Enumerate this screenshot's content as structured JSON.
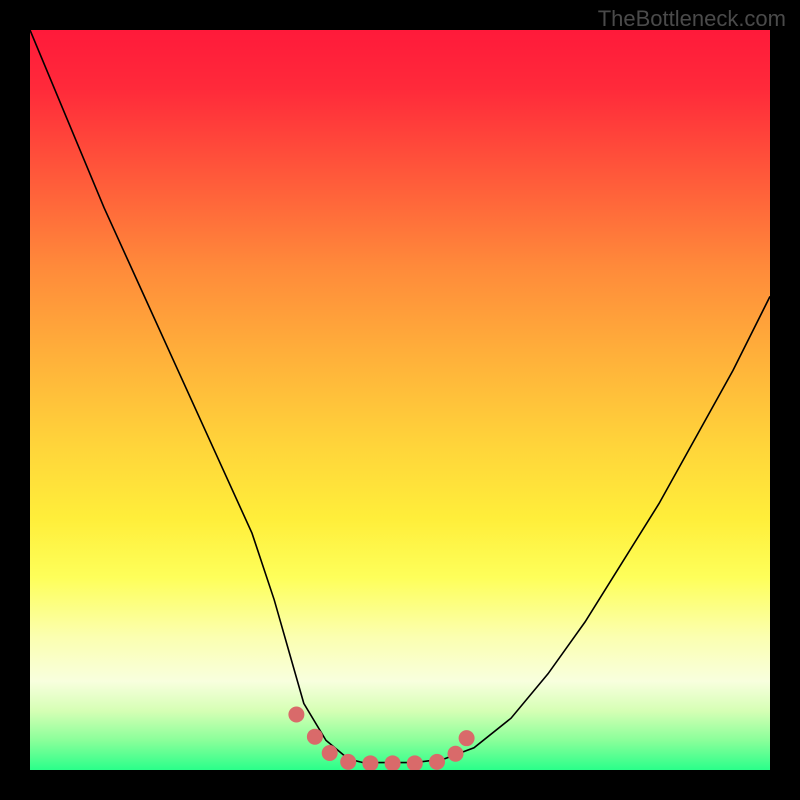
{
  "watermark": "TheBottleneck.com",
  "chart_data": {
    "type": "line",
    "title": "",
    "xlabel": "",
    "ylabel": "",
    "xlim": [
      0,
      100
    ],
    "ylim": [
      0,
      100
    ],
    "series": [
      {
        "name": "curve",
        "stroke": "#000000",
        "stroke_width": 1.6,
        "x": [
          0,
          5,
          10,
          15,
          20,
          25,
          30,
          33,
          35,
          37,
          40,
          43,
          45,
          48,
          52,
          56,
          60,
          65,
          70,
          75,
          80,
          85,
          90,
          95,
          100
        ],
        "y": [
          100,
          88,
          76,
          65,
          54,
          43,
          32,
          23,
          16,
          9,
          4,
          1.5,
          1,
          1,
          1,
          1.5,
          3,
          7,
          13,
          20,
          28,
          36,
          45,
          54,
          64
        ]
      }
    ],
    "markers": {
      "name": "bottom-markers",
      "color": "#d96a6a",
      "radius": 8,
      "points": [
        {
          "x": 36,
          "y": 7.5
        },
        {
          "x": 38.5,
          "y": 4.5
        },
        {
          "x": 40.5,
          "y": 2.3
        },
        {
          "x": 43,
          "y": 1.1
        },
        {
          "x": 46,
          "y": 0.9
        },
        {
          "x": 49,
          "y": 0.9
        },
        {
          "x": 52,
          "y": 0.9
        },
        {
          "x": 55,
          "y": 1.1
        },
        {
          "x": 57.5,
          "y": 2.2
        },
        {
          "x": 59,
          "y": 4.3
        }
      ]
    },
    "background_gradient": {
      "type": "vertical",
      "stops": [
        {
          "pos": 0.0,
          "color": "#ff1a3a"
        },
        {
          "pos": 0.2,
          "color": "#ff5a3a"
        },
        {
          "pos": 0.44,
          "color": "#ffb03a"
        },
        {
          "pos": 0.66,
          "color": "#ffee3a"
        },
        {
          "pos": 0.88,
          "color": "#f8ffde"
        },
        {
          "pos": 1.0,
          "color": "#2aff8a"
        }
      ]
    }
  }
}
